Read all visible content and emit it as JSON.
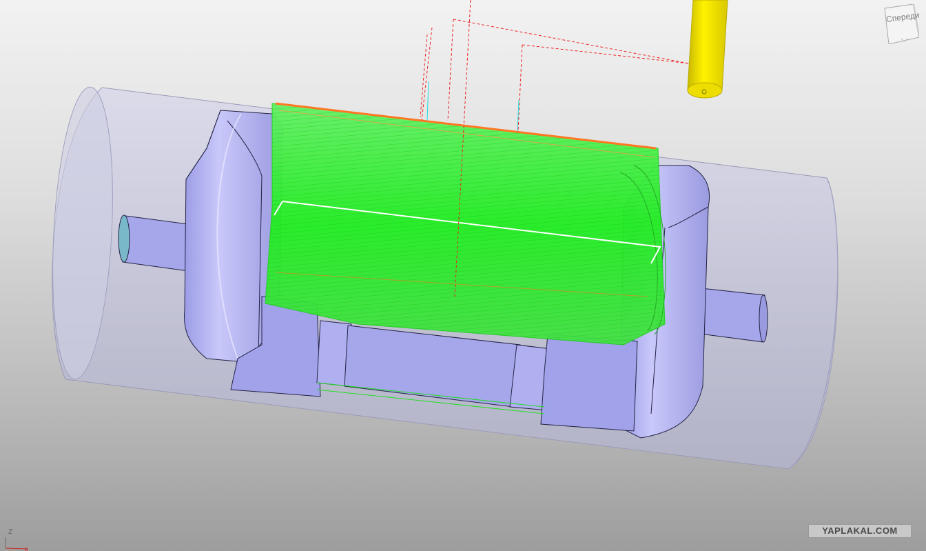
{
  "view_cube": {
    "label": "Спереди"
  },
  "axis_indicator": {
    "z_label": "Z"
  },
  "watermark": {
    "text": "YAPLAKAL.COM"
  },
  "colors": {
    "background_top": "#f2f2f2",
    "background_bottom": "#9d9d9d",
    "part": "#a9a9f0",
    "part_shadow": "#8c8cd6",
    "stock": "#c4c4dc",
    "toolpath_green": "#22ee22",
    "toolpath_orange": "#ff7722",
    "rapid_red": "#ee2222",
    "tool_yellow": "#ffee00",
    "selection_white": "#ffffff",
    "cyan": "#22dddd"
  },
  "icons": {
    "view_cube": "view-cube-icon",
    "axis": "axis-triad-icon",
    "tool": "end-mill-tool-icon"
  }
}
